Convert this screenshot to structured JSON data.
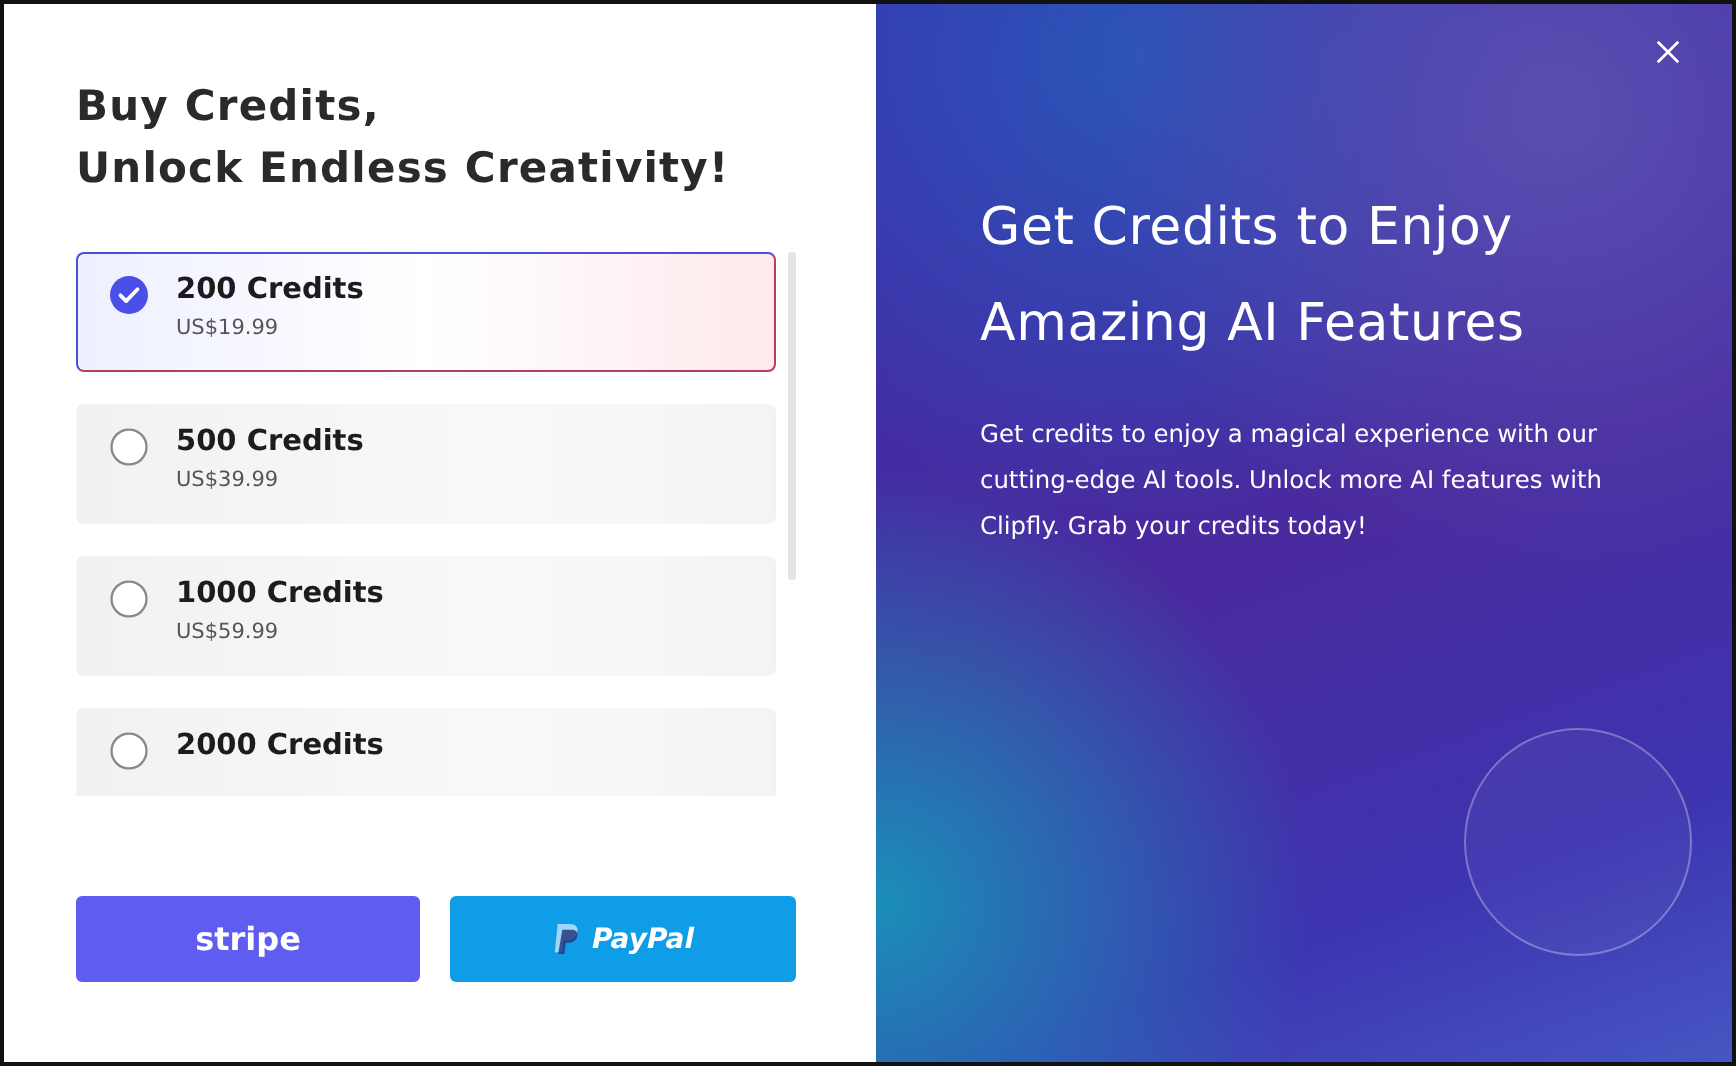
{
  "purchase": {
    "title_lines": [
      "Buy Credits,",
      "Unlock Endless Creativity!"
    ],
    "plans": [
      {
        "name": "200 Credits",
        "price": "US$19.99",
        "selected": true
      },
      {
        "name": "500 Credits",
        "price": "US$39.99",
        "selected": false
      },
      {
        "name": "1000 Credits",
        "price": "US$59.99",
        "selected": false
      },
      {
        "name": "2000 Credits",
        "selected": false
      }
    ],
    "payment_buttons": [
      {
        "kind": "stripe",
        "label": "stripe"
      },
      {
        "kind": "paypal",
        "label": "PayPal"
      }
    ]
  },
  "promo": {
    "heading_lines": [
      "Get Credits to Enjoy",
      "Amazing AI Features"
    ],
    "text": "Get credits to enjoy a magical experience with our cutting-edge AI tools. Unlock more AI features with Clipfly. Grab your credits today!"
  }
}
